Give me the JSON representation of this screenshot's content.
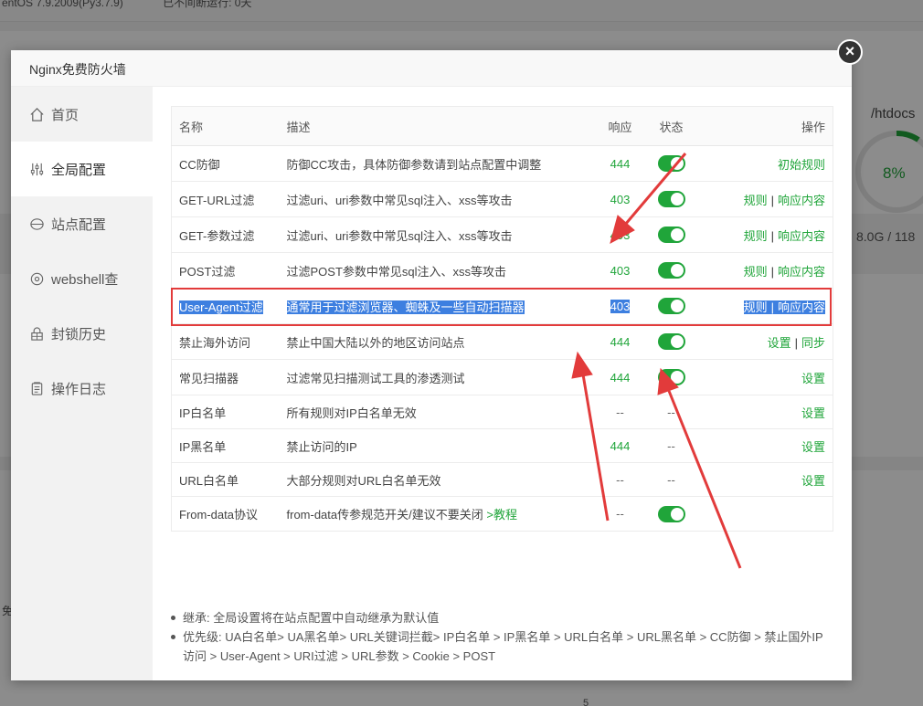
{
  "background": {
    "topbar_left": "entOS 7.9.2009(Py3.7.9)",
    "topbar_right": "已不间断运行: 0天",
    "disk_title": "/htdocs",
    "disk_percent": "8%",
    "disk_size": "8.0G / 118",
    "left_char": "免",
    "bottom_num": "5"
  },
  "modal": {
    "title": "Nginx免费防火墙",
    "close_label": "×"
  },
  "sidebar": {
    "items": [
      {
        "label": "首页",
        "icon": "home-icon"
      },
      {
        "label": "全局配置",
        "icon": "sliders-icon"
      },
      {
        "label": "站点配置",
        "icon": "globe-icon"
      },
      {
        "label": "webshell查",
        "icon": "scan-icon"
      },
      {
        "label": "封锁历史",
        "icon": "block-icon"
      },
      {
        "label": "操作日志",
        "icon": "log-icon"
      }
    ]
  },
  "table": {
    "headers": [
      "名称",
      "描述",
      "响应",
      "状态",
      "操作"
    ],
    "rows": [
      {
        "name": "CC防御",
        "desc": "防御CC攻击，具体防御参数请到站点配置中调整",
        "resp": "444",
        "toggle": true,
        "ops": [
          "初始规则"
        ]
      },
      {
        "name": "GET-URL过滤",
        "desc": "过滤uri、uri参数中常见sql注入、xss等攻击",
        "resp": "403",
        "toggle": true,
        "ops": [
          "规则",
          "响应内容"
        ]
      },
      {
        "name": "GET-参数过滤",
        "desc": "过滤uri、uri参数中常见sql注入、xss等攻击",
        "resp": "403",
        "toggle": true,
        "ops": [
          "规则",
          "响应内容"
        ]
      },
      {
        "name": "POST过滤",
        "desc": "过滤POST参数中常见sql注入、xss等攻击",
        "resp": "403",
        "toggle": true,
        "ops": [
          "规则",
          "响应内容"
        ]
      },
      {
        "name": "User-Agent过滤",
        "desc": "通常用于过滤浏览器、蜘蛛及一些自动扫描器",
        "resp": "403",
        "toggle": true,
        "ops": [
          "规则",
          "响应内容"
        ]
      },
      {
        "name": "禁止海外访问",
        "desc": "禁止中国大陆以外的地区访问站点",
        "resp": "444",
        "toggle": true,
        "ops": [
          "设置",
          "同步"
        ]
      },
      {
        "name": "常见扫描器",
        "desc": "过滤常见扫描测试工具的渗透测试",
        "resp": "444",
        "toggle": true,
        "ops": [
          "设置"
        ]
      },
      {
        "name": "IP白名单",
        "desc": "所有规则对IP白名单无效",
        "resp": "--",
        "status": "--",
        "ops": [
          "设置"
        ]
      },
      {
        "name": "IP黑名单",
        "desc": "禁止访问的IP",
        "resp": "444",
        "status": "--",
        "ops": [
          "设置"
        ]
      },
      {
        "name": "URL白名单",
        "desc": "大部分规则对URL白名单无效",
        "resp": "--",
        "status": "--",
        "ops": [
          "设置"
        ]
      },
      {
        "name": "From-data协议",
        "desc": "from-data传参规范开关/建议不要关闭",
        "desc_link": ">教程",
        "resp": "--",
        "toggle": true,
        "ops": []
      }
    ]
  },
  "notes": [
    "继承: 全局设置将在站点配置中自动继承为默认值",
    "优先级: UA白名单> UA黑名单> URL关键词拦截> IP白名单 > IP黑名单 > URL白名单 > URL黑名单 > CC防御 > 禁止国外IP访问 > User-Agent > URI过滤 > URL参数 > Cookie > POST"
  ],
  "colors": {
    "accent": "#20a53a",
    "annotation": "#e23b3b",
    "selection": "#3d7fe0"
  }
}
